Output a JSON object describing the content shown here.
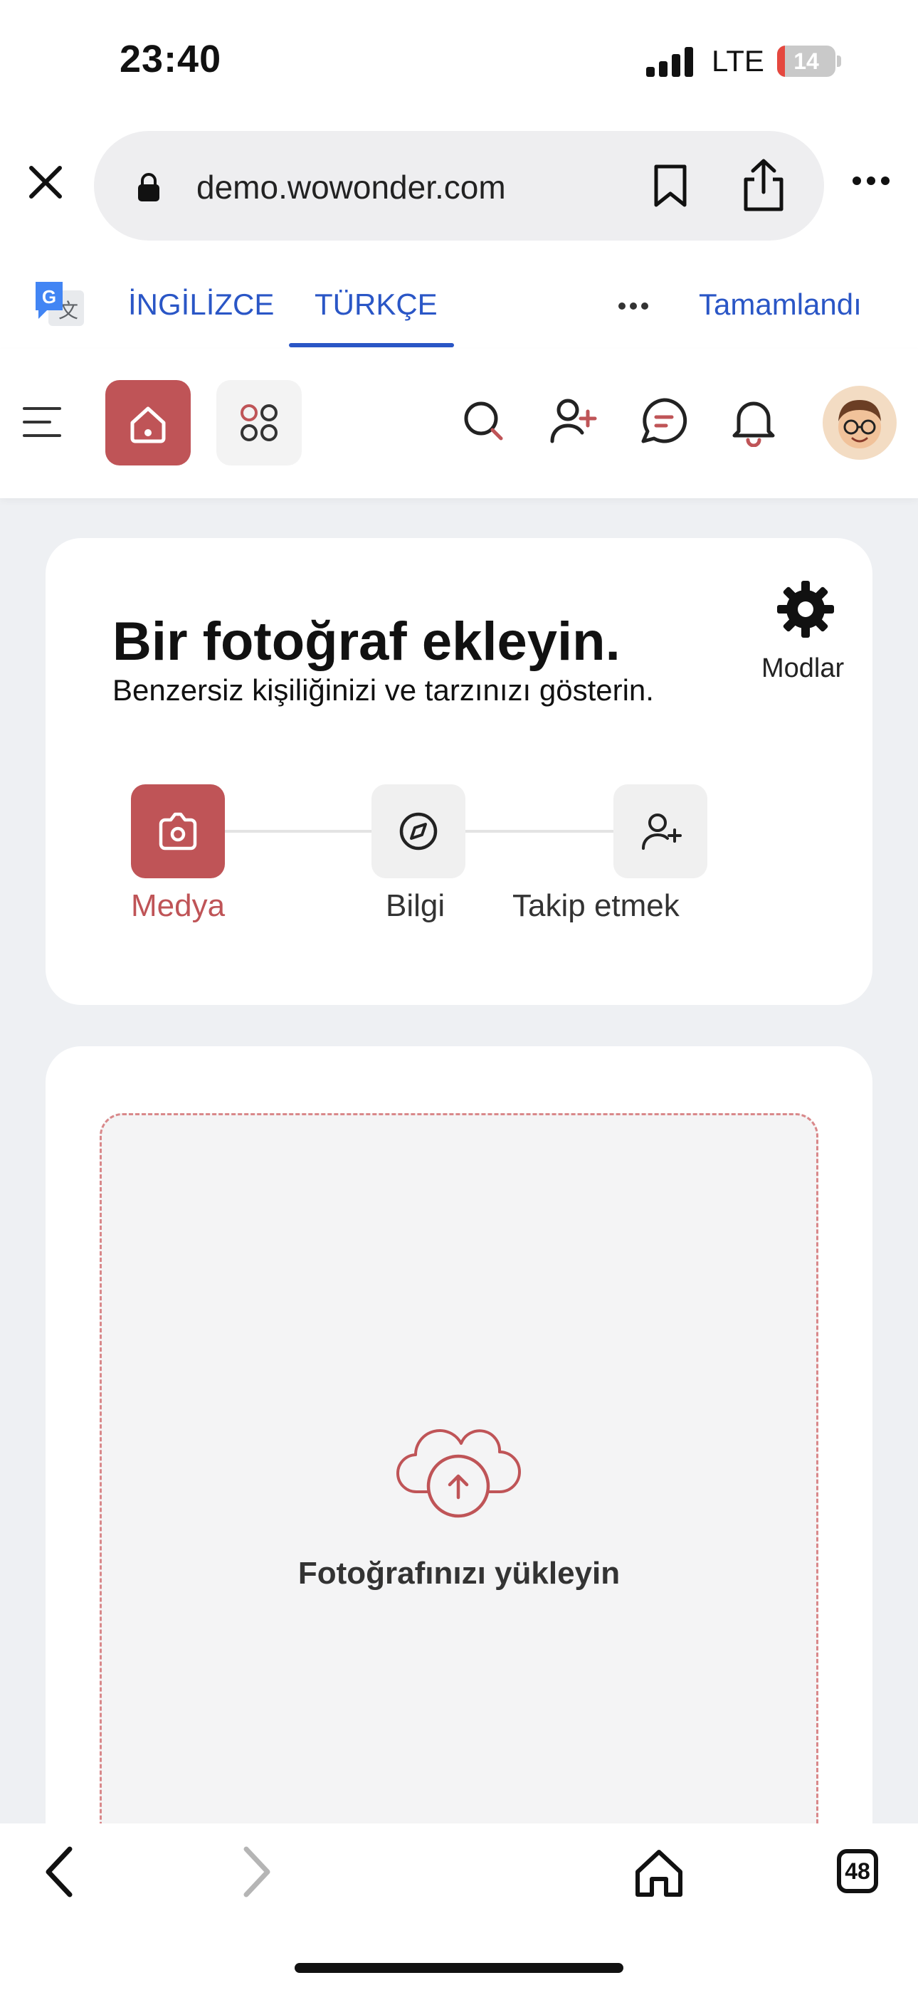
{
  "status_bar": {
    "time": "23:40",
    "network": "LTE",
    "battery_level": "14",
    "battery_fraction": 0.14
  },
  "browser": {
    "url": "demo.wowonder.com",
    "icons": [
      "close-icon",
      "lock-icon",
      "bookmark-icon",
      "share-icon",
      "more-icon"
    ]
  },
  "translate_bar": {
    "source_lang": "İNGİLİZCE",
    "target_lang": "TÜRKÇE",
    "done_label": "Tamamlandı",
    "selected": "target_lang"
  },
  "app_nav": {
    "icons": [
      "menu-icon",
      "home-icon",
      "apps-icon",
      "search-icon",
      "add-user-icon",
      "chat-icon",
      "bell-icon",
      "avatar"
    ],
    "active": "home-icon"
  },
  "onboarding": {
    "title": "Bir fotoğraf ekleyin.",
    "subtitle": "Benzersiz kişiliğinizi ve tarzınızı gösterin.",
    "modes_label": "Modlar",
    "steps": [
      {
        "label": "Medya",
        "icon": "camera-icon",
        "active": true
      },
      {
        "label": "Bilgi",
        "icon": "compass-icon",
        "active": false
      },
      {
        "label": "Takip etmek",
        "icon": "add-user-icon",
        "active": false
      }
    ]
  },
  "upload": {
    "label": "Fotoğrafınızı yükleyin",
    "icon": "cloud-upload-icon"
  },
  "toolbar": {
    "tabs_count": "48"
  },
  "colors": {
    "accent": "#bf5457",
    "link_blue": "#2a56c6",
    "page_bg": "#eef0f3"
  }
}
